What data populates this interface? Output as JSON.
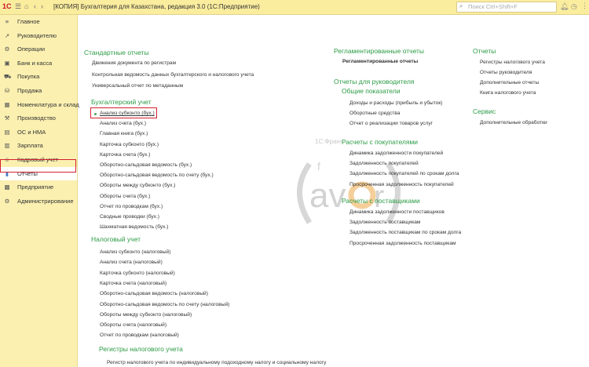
{
  "titlebar": {
    "logo": "1С",
    "title": "[КОПИЯ] Бухгалтерия для Казахстана, редакция 3.0  (1С:Предприятие)",
    "search_placeholder": "Поиск Ctrl+Shift+F"
  },
  "sidebar": {
    "items": [
      {
        "label": "Главное",
        "icon": "≡"
      },
      {
        "label": "Руководителю",
        "icon": "↗"
      },
      {
        "label": "Операции",
        "icon": "⚙"
      },
      {
        "label": "Банк и касса",
        "icon": "▣"
      },
      {
        "label": "Покупка",
        "icon": "⛟"
      },
      {
        "label": "Продажа",
        "icon": "⛁"
      },
      {
        "label": "Номенклатура и склад",
        "icon": "▦"
      },
      {
        "label": "Производство",
        "icon": "⚒"
      },
      {
        "label": "ОС и НМА",
        "icon": "▤"
      },
      {
        "label": "Зарплата",
        "icon": "▥"
      },
      {
        "label": "Кадровый учет",
        "icon": "☺"
      },
      {
        "label": "Отчеты",
        "icon": "▮"
      },
      {
        "label": "Предприятие",
        "icon": "▩"
      },
      {
        "label": "Администрирование",
        "icon": "⚙"
      }
    ]
  },
  "watermark": {
    "text": "1С:Франч",
    "logo": "favor-t"
  },
  "col1": {
    "standard": {
      "title": "Стандартные отчеты",
      "items": [
        "Движения документа по регистрам",
        "Контрольная ведомость данных бухгалтерского и налогового учета",
        "Универсальный отчет по метаданным"
      ]
    },
    "accounting": {
      "title": "Бухгалтерский учет",
      "items": [
        "Анализ субконто (бух.)",
        "Анализ счета (бух.)",
        "Главная книга (бух.)",
        "Карточка субконто (бух.)",
        "Карточка счета (бух.)",
        "Оборотно-сальдовая ведомость (бух.)",
        "Оборотно-сальдовая ведомость по счету (бух.)",
        "Обороты между субконто (бух.)",
        "Обороты счета (бух.)",
        "Отчет по проводкам (бух.)",
        "Сводные проводки (бух.)",
        "Шахматная ведомость (бух.)"
      ]
    },
    "tax": {
      "title": "Налоговый учет",
      "items": [
        "Анализ субконто (налоговый)",
        "Анализ счета (налоговый)",
        "Карточка субконто (налоговый)",
        "Карточка счета (налоговый)",
        "Оборотно-сальдовая ведомость (налоговый)",
        "Оборотно-сальдовая ведомость по счету (налоговый)",
        "Обороты между субконто (налоговый)",
        "Обороты счета (налоговый)",
        "Отчет по проводкам (налоговый)"
      ]
    },
    "registers": {
      "title": "Регистры налогового учета",
      "items": [
        "Регистр налогового учета по индивидуальному подоходному налогу и социальному налогу"
      ]
    }
  },
  "col2": {
    "regulated": {
      "title": "Регламентированные отчеты",
      "items": [
        "Регламентированные отчеты"
      ]
    },
    "managers": {
      "title": "Отчеты для руководителя"
    },
    "general": {
      "title": "Общие показатели",
      "items": [
        "Доходы и расходы (прибыль и убыток)",
        "Оборотные средства",
        "Отчет о реализации товаров услуг"
      ]
    },
    "buyers": {
      "title": "Расчеты с покупателями",
      "items": [
        "Динамика задолженности покупателей",
        "Задолженность покупателей",
        "Задолженность покупателей по срокам долга",
        "Просроченная задолженность покупателей"
      ]
    },
    "suppliers": {
      "title": "Расчеты с поставщиками",
      "items": [
        "Динамика задолженности поставщиков",
        "Задолженность поставщикам",
        "Задолженность поставщикам по срокам долга",
        "Просроченная задолженность поставщикам"
      ]
    }
  },
  "col3": {
    "reports": {
      "title": "Отчеты",
      "items": [
        "Регистры налогового учета",
        "Отчеты руководителя",
        "Дополнительные отчеты",
        "Книга налогового учета"
      ]
    },
    "service": {
      "title": "Сервис",
      "items": [
        "Дополнительные обработки"
      ]
    }
  }
}
